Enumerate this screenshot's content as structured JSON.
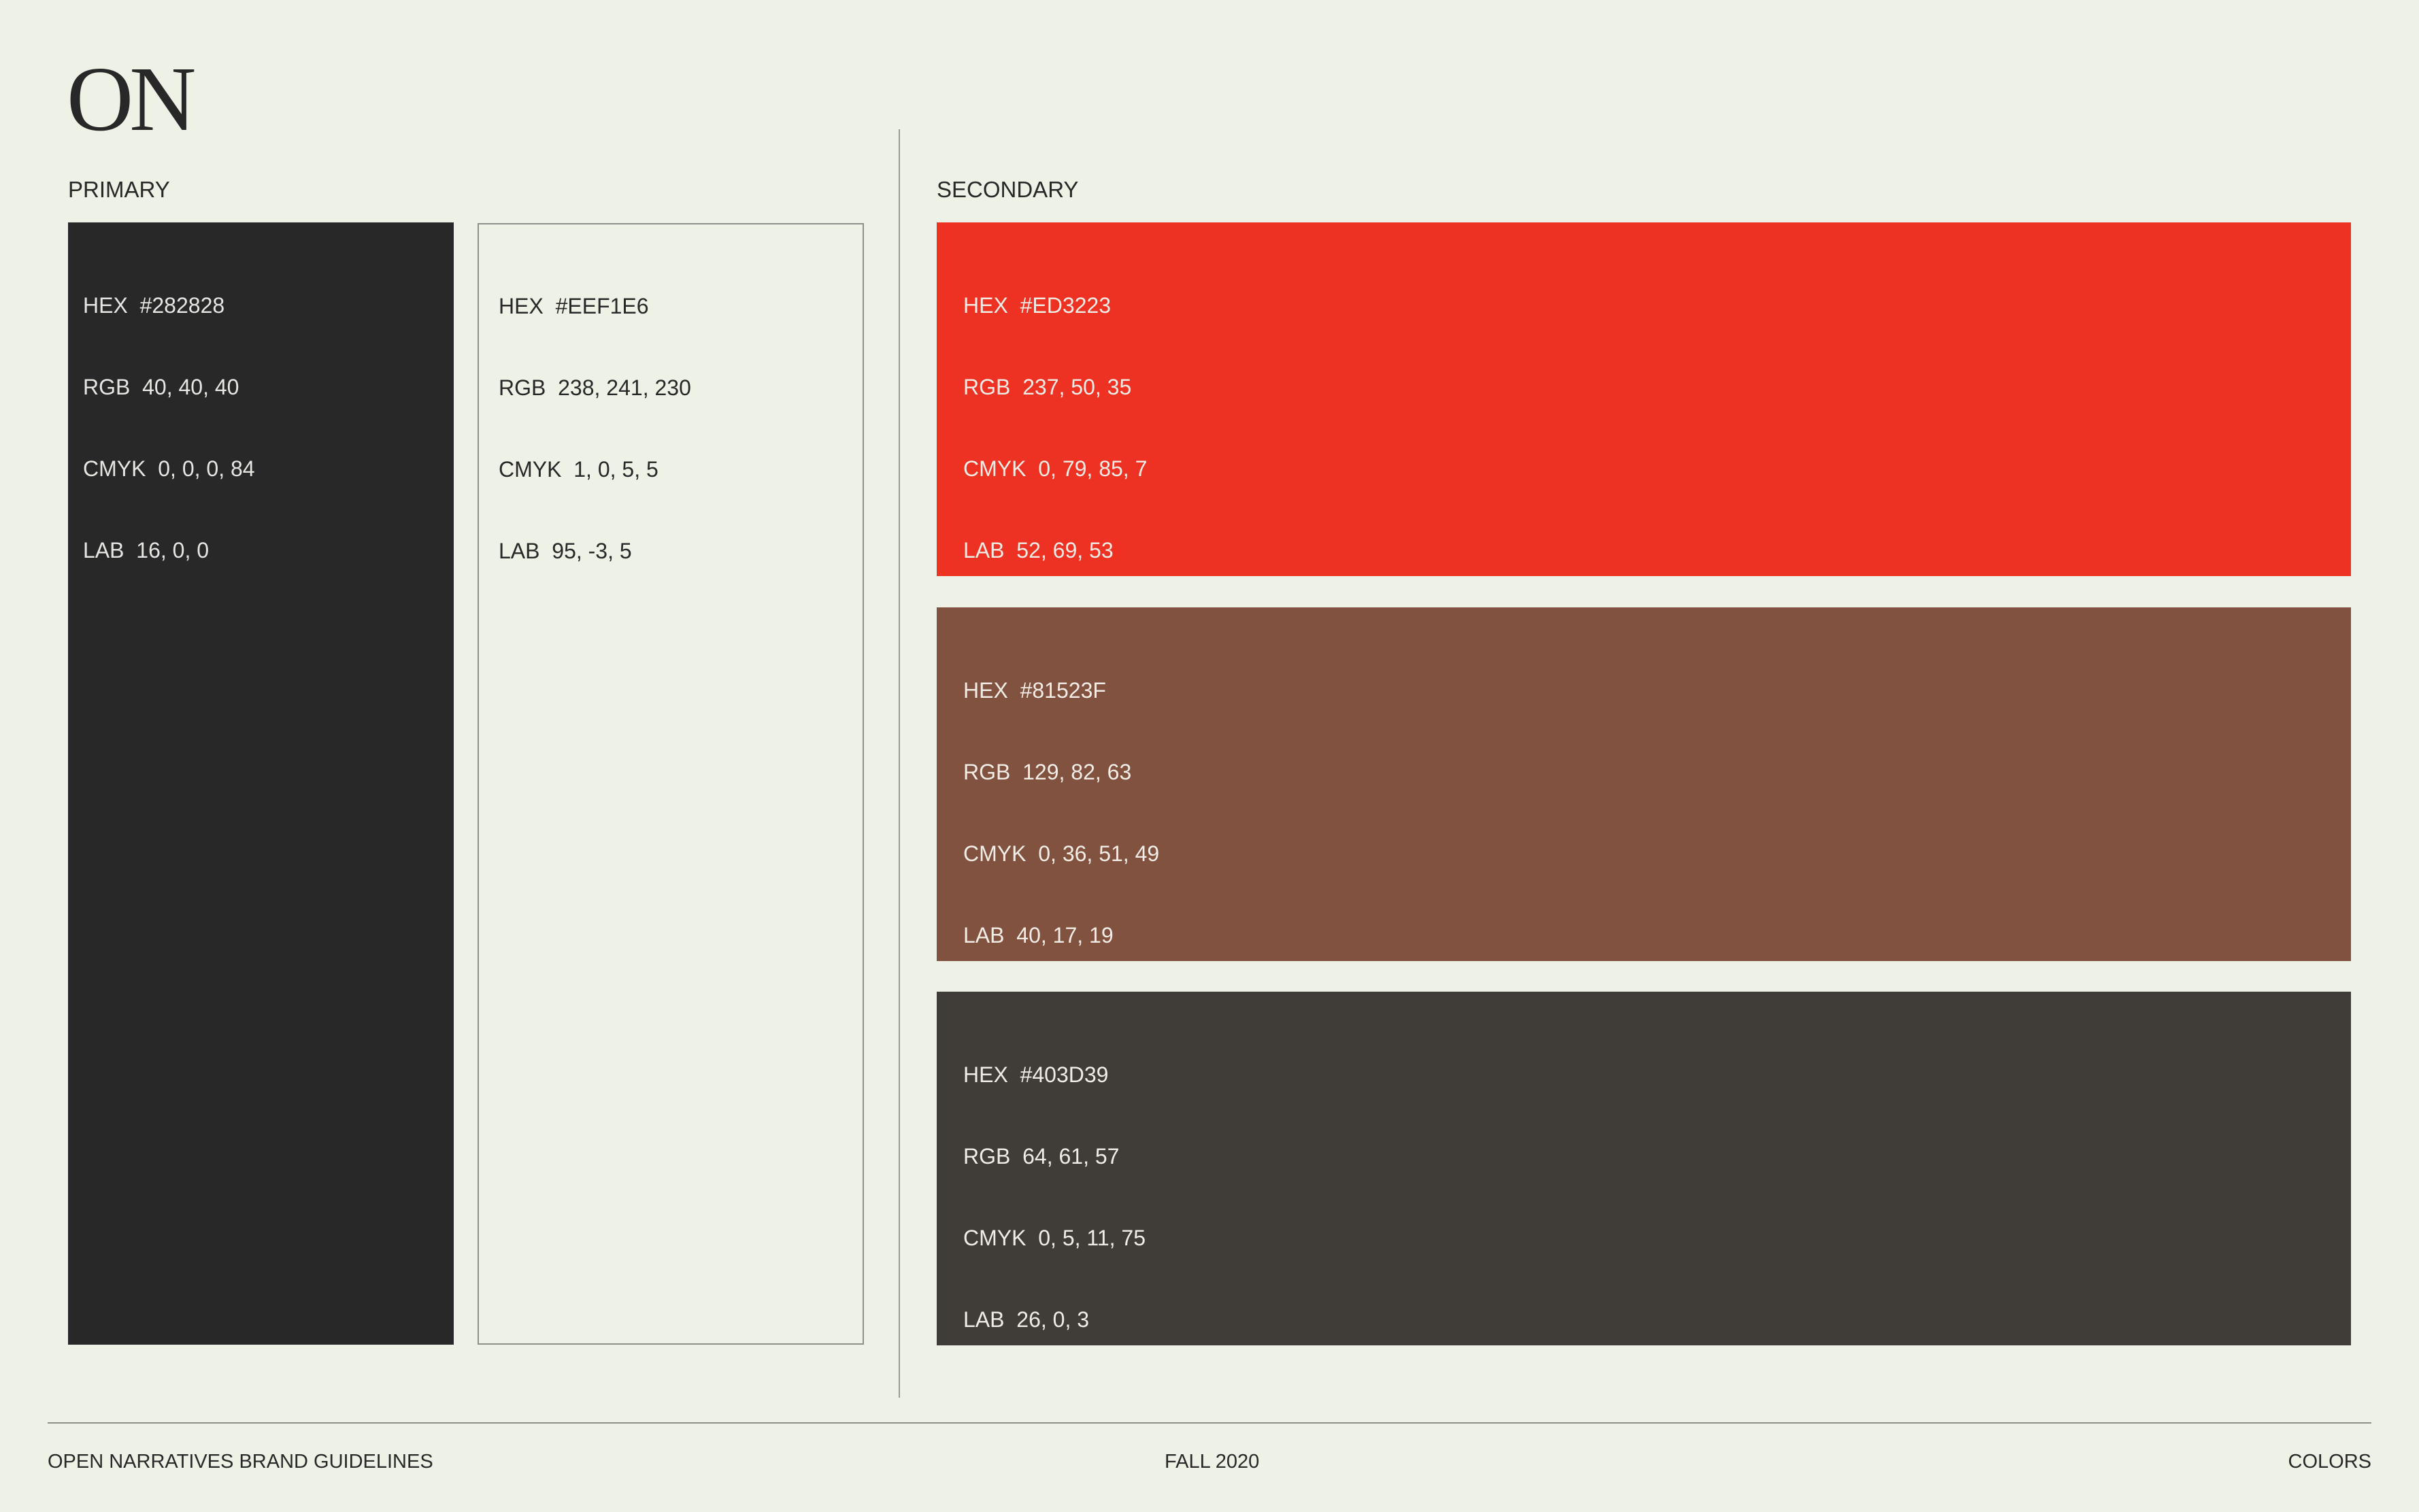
{
  "logo": "ON",
  "primary": {
    "label": "PRIMARY",
    "swatches": [
      {
        "color": "#282828",
        "hex": "HEX  #282828",
        "rgb": "RGB  40, 40, 40",
        "cmyk": "CMYK  0, 0, 0, 84",
        "lab": "LAB  16, 0, 0"
      },
      {
        "color": "#EEF1E6",
        "hex": "HEX  #EEF1E6",
        "rgb": "RGB  238, 241, 230",
        "cmyk": "CMYK  1, 0, 5, 5",
        "lab": "LAB  95, -3, 5"
      }
    ]
  },
  "secondary": {
    "label": "SECONDARY",
    "swatches": [
      {
        "color": "#ED3223",
        "hex": "HEX  #ED3223",
        "rgb": "RGB  237, 50, 35",
        "cmyk": "CMYK  0, 79, 85, 7",
        "lab": "LAB  52, 69, 53"
      },
      {
        "color": "#81523F",
        "hex": "HEX  #81523F",
        "rgb": "RGB  129, 82, 63",
        "cmyk": "CMYK  0, 36, 51, 49",
        "lab": "LAB  40, 17, 19"
      },
      {
        "color": "#403D39",
        "hex": "HEX  #403D39",
        "rgb": "RGB  64, 61, 57",
        "cmyk": "CMYK  0, 5, 11, 75",
        "lab": "LAB  26, 0, 3"
      }
    ]
  },
  "footer": {
    "left": "OPEN NARRATIVES BRAND GUIDELINES",
    "center": "FALL 2020",
    "right": "COLORS"
  }
}
